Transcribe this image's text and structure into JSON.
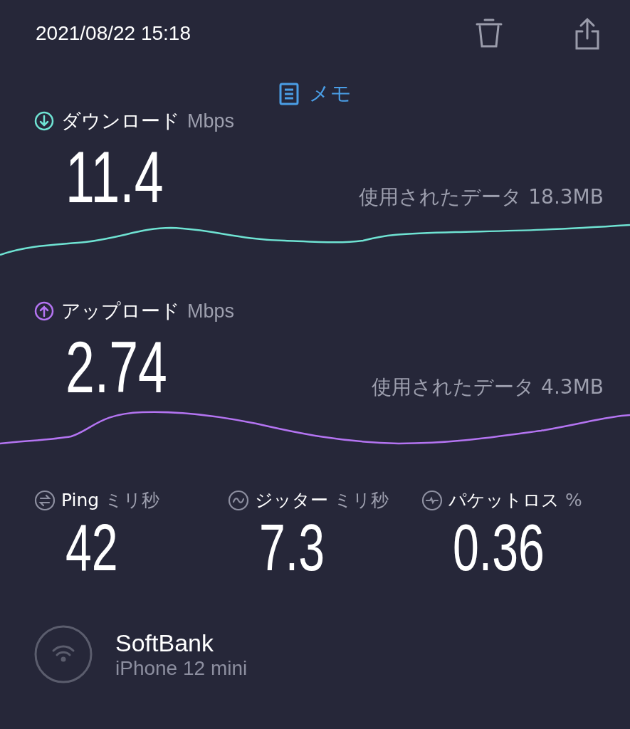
{
  "header": {
    "datetime": "2021/08/22 15:18"
  },
  "memo": {
    "label": "メモ"
  },
  "speeds": [
    {
      "kind": "download",
      "label": "ダウンロード",
      "unit": "Mbps",
      "value": "11.4",
      "data_used": "使用されたデータ 18.3MB",
      "color": "#6fe3d3"
    },
    {
      "kind": "upload",
      "label": "アップロード",
      "unit": "Mbps",
      "value": "2.74",
      "data_used": "使用されたデータ 4.3MB",
      "color": "#b474f2"
    }
  ],
  "stats": [
    {
      "kind": "ping",
      "label": "Ping",
      "unit": "ミリ秒",
      "value": "42"
    },
    {
      "kind": "jitter",
      "label": "ジッター",
      "unit": "ミリ秒",
      "value": "7.3"
    },
    {
      "kind": "loss",
      "label": "パケットロス",
      "unit": "%",
      "value": "0.36"
    }
  ],
  "connection": {
    "provider": "SoftBank",
    "device": "iPhone 12 mini"
  }
}
